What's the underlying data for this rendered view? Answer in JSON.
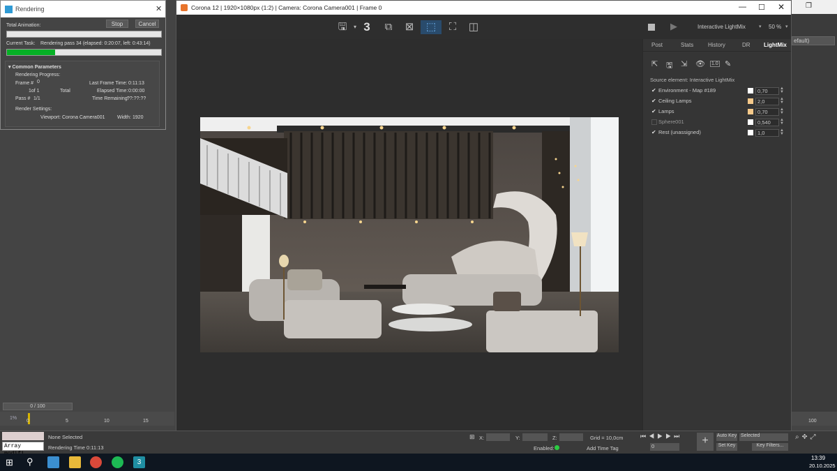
{
  "rendering_dialog": {
    "title": "Rendering",
    "total_animation_label": "Total Animation:",
    "stop_label": "Stop",
    "cancel_label": "Cancel",
    "current_task_label": "Current Task:",
    "current_task_value": "Rendering pass 34 (elapsed: 0:20:07, left: 0:43:14)",
    "progress": 0.31,
    "section_title": "Common Parameters",
    "rendering_progress_label": "Rendering Progress:",
    "frame_label": "Frame #",
    "frame_value": "0",
    "of_label": "1of 1",
    "total_label": "Total",
    "pass_label": "Pass #",
    "pass_value": "1/1",
    "last_frame_time_label": "Last Frame Time:",
    "last_frame_time_value": "0:11:13",
    "elapsed_label": "Elapsed Time:",
    "elapsed_value": "0:00:00",
    "remaining_label": "Time Remaining:",
    "remaining_value": "??:??:??",
    "render_settings_label": "Render Settings:",
    "viewport_label": "Viewport:",
    "viewport_value": "Corona Camera001",
    "width_label": "Width:",
    "width_value": "1920"
  },
  "vfb": {
    "title": "Corona 12 | 1920×1080px (1:2) | Camera: Corona Camera001 | Frame 0",
    "toolbar_number": "3",
    "interactive_label": "Interactive LightMix",
    "zoom_label": "50 %",
    "tabs": [
      "Post",
      "Stats",
      "History",
      "DR",
      "LightMix"
    ],
    "active_tab": "LightMix",
    "source_element": "Source element: Interactive LightMix",
    "lightmix": [
      {
        "name": "Environment - Map #189",
        "checked": true,
        "color": "#ffffff",
        "value": "0,70"
      },
      {
        "name": "Ceiling Lamps",
        "checked": true,
        "color": "#f5c98a",
        "value": "2,0"
      },
      {
        "name": "Lamps",
        "checked": true,
        "color": "#f5c98a",
        "value": "0,70"
      },
      {
        "name": "Sphere001",
        "checked": false,
        "color": "#ffffff",
        "value": "0,540"
      },
      {
        "name": "Rest (unassigned)",
        "checked": true,
        "color": "#ffffff",
        "value": "1,0"
      }
    ]
  },
  "max_ui": {
    "dropdown_partial": "efault)",
    "timeline_counter": "0 / 100",
    "timeline_ticks": [
      "0",
      "5",
      "10",
      "15",
      "100"
    ],
    "command_input": "Array modifi",
    "status_line1": "None Selected",
    "status_line2": "Rendering Time  0:11:13",
    "x_label": "X:",
    "y_label": "Y:",
    "z_label": "Z:",
    "grid_label": "Grid = 10,0cm",
    "enabled_label": "Enabled:",
    "add_time_tag": "Add Time Tag",
    "auto_key": "Auto Key",
    "set_key": "Set Key",
    "selected_dropdown": "Selected",
    "key_filters": "Key Filters...",
    "frame_field": "0"
  },
  "taskbar": {
    "time": "13:39",
    "date": "20.10.2025"
  }
}
